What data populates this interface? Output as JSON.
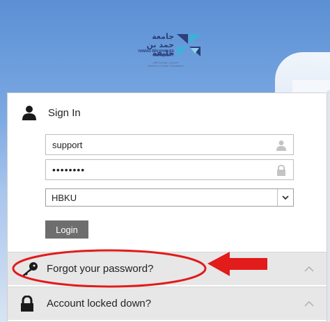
{
  "logo": {
    "arabic_line1": "جامعة",
    "arabic_line2": "حمد بن خليفة",
    "english_line1": "HAMAD BIN KHALIFA",
    "english_line2": "UNIVERSITY",
    "subtitle_arabic": "عضو في مؤسسة قطر",
    "subtitle_english": "Member of Qatar Foundation"
  },
  "signin": {
    "title": "Sign In",
    "username_value": "support",
    "password_value": "••••••••",
    "domain_selected": "HBKU",
    "login_label": "Login"
  },
  "links": {
    "forgot_password": "Forgot your password?",
    "account_locked": "Account locked down?"
  },
  "colors": {
    "annotation_red": "#e21b1b",
    "button_gray": "#6e6e6e",
    "row_gray": "#e7e7e7"
  }
}
